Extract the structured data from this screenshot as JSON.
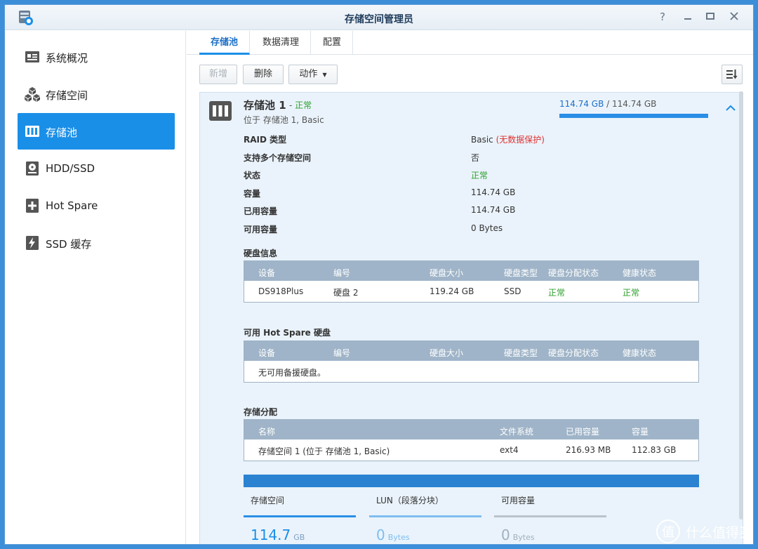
{
  "window": {
    "title": "存储空间管理员"
  },
  "sidebar": {
    "items": [
      {
        "label": "系统概况",
        "icon": "overview-icon"
      },
      {
        "label": "存储空间",
        "icon": "volume-cubes-icon"
      },
      {
        "label": "存储池",
        "icon": "storage-pool-icon",
        "active": true
      },
      {
        "label": "HDD/SSD",
        "icon": "disk-icon"
      },
      {
        "label": "Hot Spare",
        "icon": "hot-spare-plus-icon"
      },
      {
        "label": "SSD 缓存",
        "icon": "ssd-cache-bolt-icon"
      }
    ]
  },
  "tabs": [
    "存储池",
    "数据清理",
    "配置"
  ],
  "toolbar": {
    "new_label": "新增",
    "delete_label": "删除",
    "action_label": "动作"
  },
  "pool": {
    "name": "存储池 1",
    "status_sep": " - ",
    "status": "正常",
    "location": "位于 存储池 1, Basic",
    "used_capacity": "114.74 GB",
    "capacity_separator": " / ",
    "total_capacity": "114.74 GB",
    "usage_fraction": 1.0,
    "properties": [
      {
        "key": "RAID 类型",
        "value": "Basic",
        "note": "(无数据保护)"
      },
      {
        "key": "支持多个存储空间",
        "value": "否"
      },
      {
        "key": "状态",
        "value": "正常"
      },
      {
        "key": "容量",
        "value": "114.74 GB"
      },
      {
        "key": "已用容量",
        "value": "114.74 GB"
      },
      {
        "key": "可用容量",
        "value": "0 Bytes"
      }
    ]
  },
  "disk_info": {
    "title": "硬盘信息",
    "headers": [
      "设备",
      "编号",
      "硬盘大小",
      "硬盘类型",
      "硬盘分配状态",
      "健康状态"
    ],
    "rows": [
      [
        "DS918Plus",
        "硬盘 2",
        "119.24 GB",
        "SSD",
        "正常",
        "正常"
      ]
    ]
  },
  "hot_spare": {
    "title": "可用 Hot Spare 硬盘",
    "headers": [
      "设备",
      "编号",
      "硬盘大小",
      "硬盘类型",
      "硬盘分配状态",
      "健康状态"
    ],
    "empty_text": "无可用备援硬盘。"
  },
  "allocation": {
    "title": "存储分配",
    "headers": [
      "名称",
      "文件系统",
      "已用容量",
      "容量"
    ],
    "rows": [
      [
        "存储空间 1 (位于 存储池 1, Basic)",
        "ext4",
        "216.93 MB",
        "112.83 GB"
      ]
    ]
  },
  "usage_legend": [
    {
      "label": "存储空间",
      "value": "114.7",
      "unit": "GB",
      "color": "#2a8ee6"
    },
    {
      "label": "LUN（段落分块）",
      "value": "0",
      "unit": "Bytes",
      "color": "#7fbdf0"
    },
    {
      "label": "可用容量",
      "value": "0",
      "unit": "Bytes",
      "color": "#b9c3cc"
    }
  ],
  "watermark": {
    "circle_text": "值",
    "text": "什么值得买"
  },
  "colors": {
    "accent": "#1a8fe8",
    "ok": "#2ca02c",
    "warn": "#e03030",
    "header": "#9fb4c8"
  }
}
